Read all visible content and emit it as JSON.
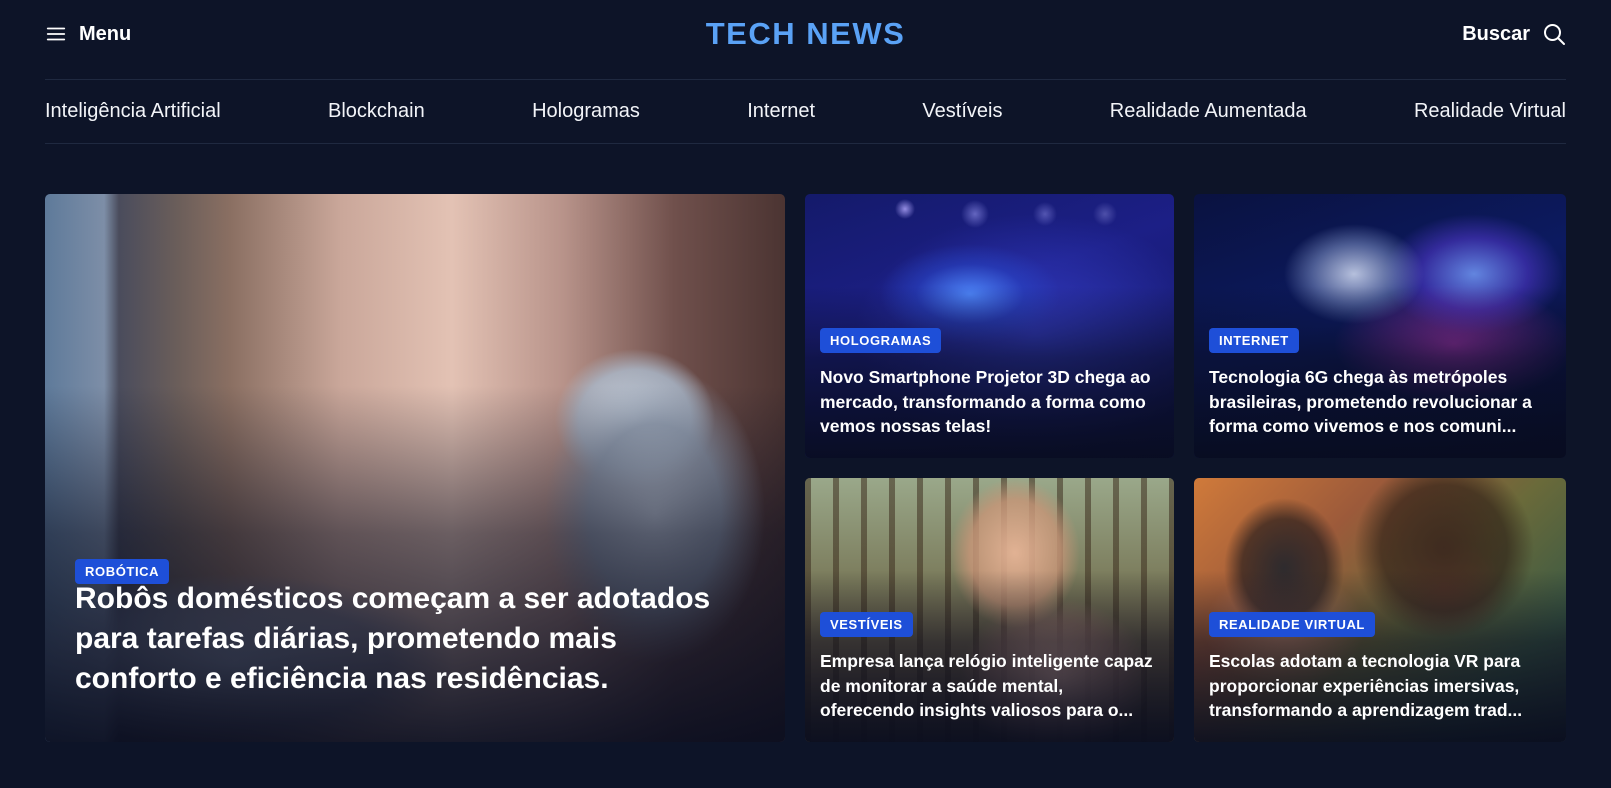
{
  "header": {
    "menu_label": "Menu",
    "logo": "TECH NEWS",
    "search_label": "Buscar",
    "logo_color": "#5aa2f6"
  },
  "nav": {
    "items": [
      {
        "label": "Inteligência Artificial"
      },
      {
        "label": "Blockchain"
      },
      {
        "label": "Hologramas"
      },
      {
        "label": "Internet"
      },
      {
        "label": "Vestíveis"
      },
      {
        "label": "Realidade Aumentada"
      },
      {
        "label": "Realidade Virtual"
      }
    ]
  },
  "featured": {
    "category": "ROBÓTICA",
    "title": "Robôs domésticos começam a ser adotados para tarefas diárias, prometendo mais conforto e eficiência nas residências."
  },
  "articles": [
    {
      "category": "HOLOGRAMAS",
      "title": "Novo Smartphone Projetor 3D chega ao mercado, transformando a forma como vemos nossas telas!"
    },
    {
      "category": "INTERNET",
      "title": "Tecnologia 6G chega às metrópoles brasileiras, prometendo revolucionar a forma como vivemos e nos comuni..."
    },
    {
      "category": "VESTÍVEIS",
      "title": "Empresa lança relógio inteligente capaz de monitorar a saúde mental, oferecendo insights valiosos para o..."
    },
    {
      "category": "REALIDADE VIRTUAL",
      "title": "Escolas adotam a tecnologia VR para proporcionar experiências imersivas, transformando a aprendizagem trad..."
    }
  ],
  "colors": {
    "background": "#0d1428",
    "badge": "#1e4fd8",
    "divider": "#1f2940"
  },
  "icons": {
    "menu": "hamburger-icon",
    "search": "search-icon"
  }
}
